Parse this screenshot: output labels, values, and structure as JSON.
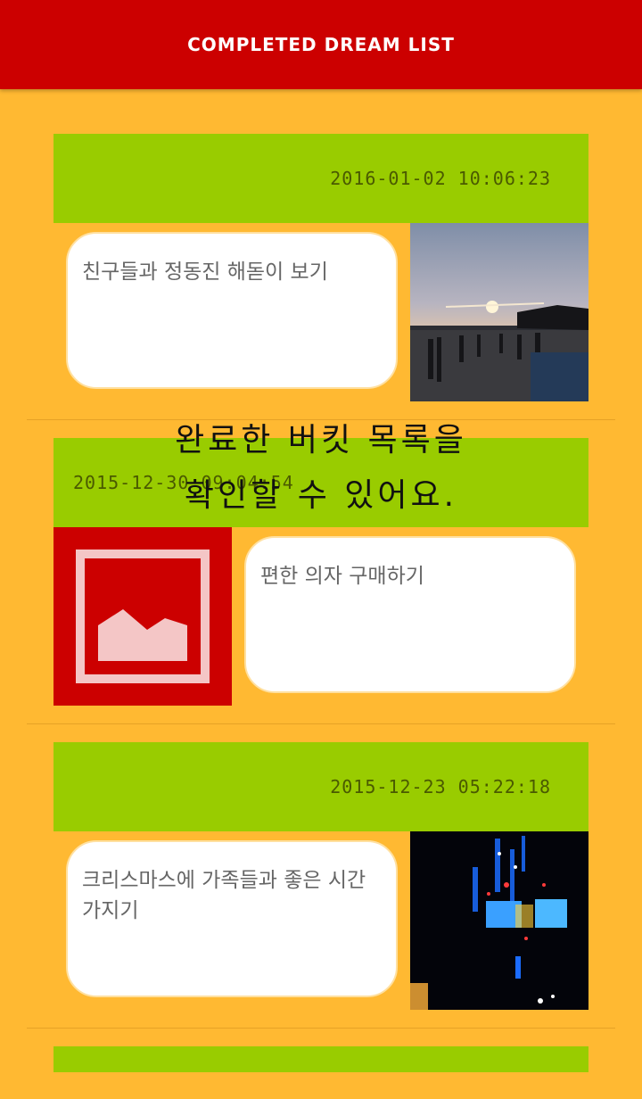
{
  "header": {
    "title": "COMPLETED DREAM LIST"
  },
  "overlay": {
    "line1": "완료한 버킷 목록을",
    "line2": "확인할 수 있어요."
  },
  "items": [
    {
      "date": "2016-01-02 10:06:23",
      "text": "친구들과 정동진 해돋이 보기",
      "image": "sunrise-beach-photo"
    },
    {
      "date": "2015-12-30 09:04:54",
      "text": "편한 의자 구매하기",
      "image": "placeholder-image-icon"
    },
    {
      "date": "2015-12-23 05:22:18",
      "text": "크리스마스에 가족들과 좋은 시간 가지기",
      "image": "christmas-lights-photo"
    }
  ],
  "colors": {
    "appbar": "#cc0000",
    "background": "#ffb932",
    "card_header": "#99cc00"
  }
}
